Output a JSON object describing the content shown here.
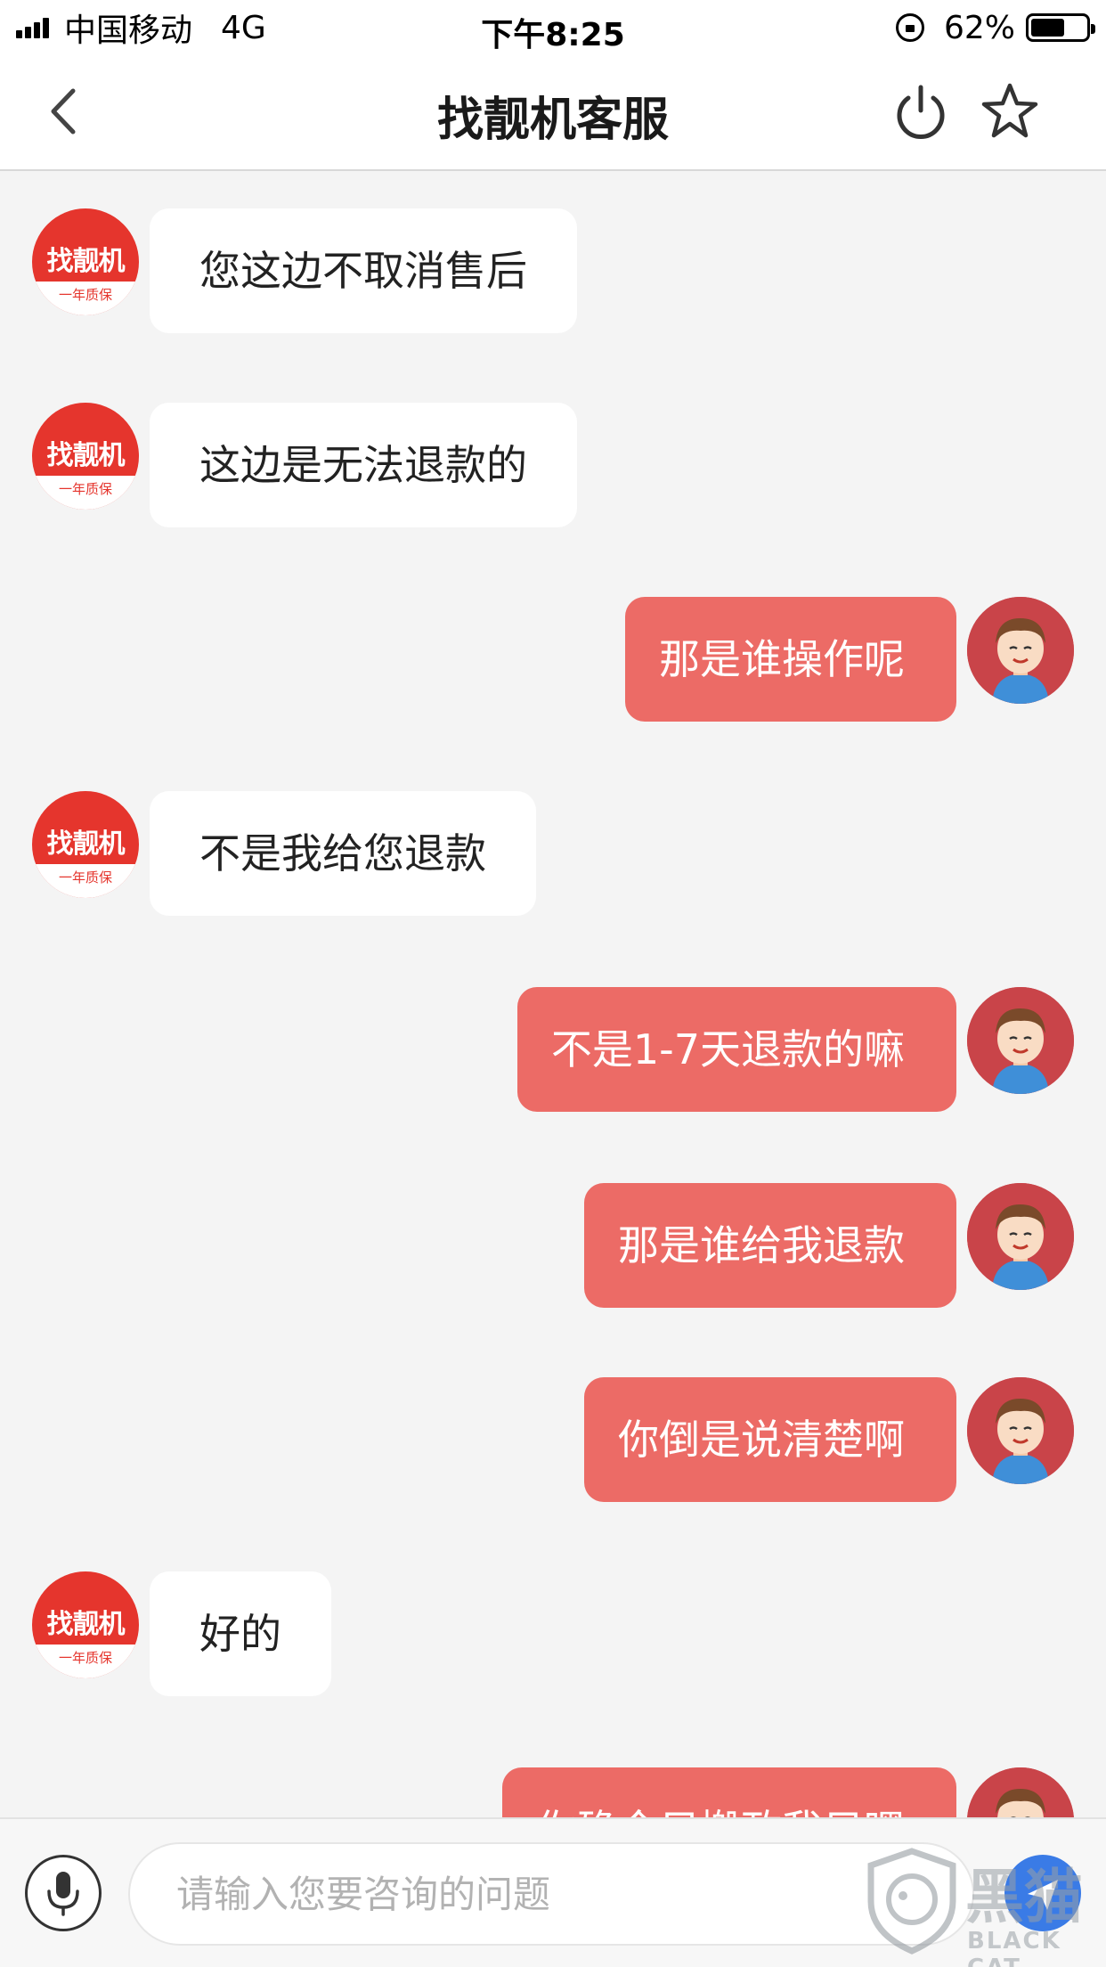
{
  "status_bar": {
    "carrier": "中国移动",
    "network": "4G",
    "time": "下午8:25",
    "battery_percent_text": "62%",
    "battery_level": 0.62
  },
  "nav": {
    "title": "找靓机客服",
    "icons": [
      "chevron-left-icon",
      "power-icon",
      "star-icon"
    ]
  },
  "agent": {
    "brand": "找靓机",
    "slogan": "一年质保"
  },
  "messages": [
    {
      "from": "agent",
      "text": "您这边不取消售后"
    },
    {
      "from": "agent",
      "text": "这边是无法退款的"
    },
    {
      "from": "user",
      "text": "那是谁操作呢"
    },
    {
      "from": "agent",
      "text": "不是我给您退款"
    },
    {
      "from": "user",
      "text": "不是1-7天退款的嘛"
    },
    {
      "from": "user",
      "text": "那是谁给我退款"
    },
    {
      "from": "user",
      "text": "你倒是说清楚啊"
    },
    {
      "from": "agent",
      "text": "好的"
    },
    {
      "from": "user",
      "text": "你确今只搬政我只嘿"
    }
  ],
  "input": {
    "placeholder": "请输入您要咨询的问题"
  },
  "watermark": {
    "text": "黑猫",
    "sub": "BLACK CAT"
  },
  "colors": {
    "agent_red": "#e5352d",
    "user_bubble": "#ec6b66",
    "background": "#f4f4f4",
    "send_blue": "#3a7be6"
  }
}
